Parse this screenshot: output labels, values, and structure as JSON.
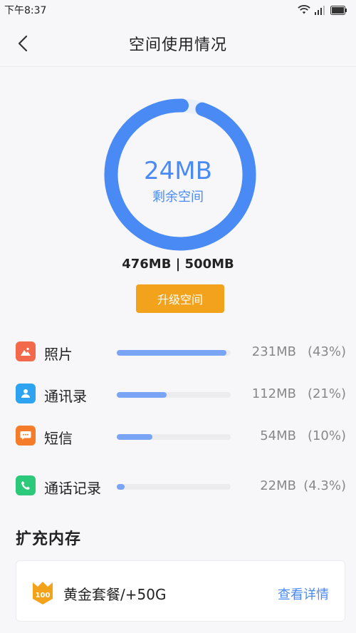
{
  "status_bar": {
    "time": "下午8:37"
  },
  "nav": {
    "title": "空间使用情况"
  },
  "storage": {
    "remaining": "24MB",
    "remaining_label": "剩余空间",
    "usage_text": "476MB | 500MB",
    "used_fraction": 0.952
  },
  "upgrade_button": {
    "label": "升级空间"
  },
  "categories": [
    {
      "label": "照片",
      "size": "231MB",
      "percent": "(43%)",
      "fraction": 0.96,
      "icon": "photo-icon",
      "color": "#f26a4b"
    },
    {
      "label": "通讯录",
      "size": "112MB",
      "percent": "(21%)",
      "fraction": 0.44,
      "icon": "contacts-icon",
      "color": "#2ea3f2"
    },
    {
      "label": "短信",
      "size": "54MB",
      "percent": "(10%)",
      "fraction": 0.31,
      "icon": "message-icon",
      "color": "#f57c28"
    },
    {
      "label": "通话记录",
      "size": "22MB",
      "percent": "(4.3%)",
      "fraction": 0.07,
      "icon": "phone-icon",
      "color": "#2cc97a"
    }
  ],
  "expand_section": {
    "title": "扩充内存"
  },
  "plan": {
    "badge": "100",
    "name": "黄金套餐/+50G",
    "link": "查看详情"
  },
  "colors": {
    "accent": "#4a8af4",
    "gauge_track": "#e9f0fc",
    "button": "#f2a21b",
    "bar": "#7aa4f5"
  }
}
